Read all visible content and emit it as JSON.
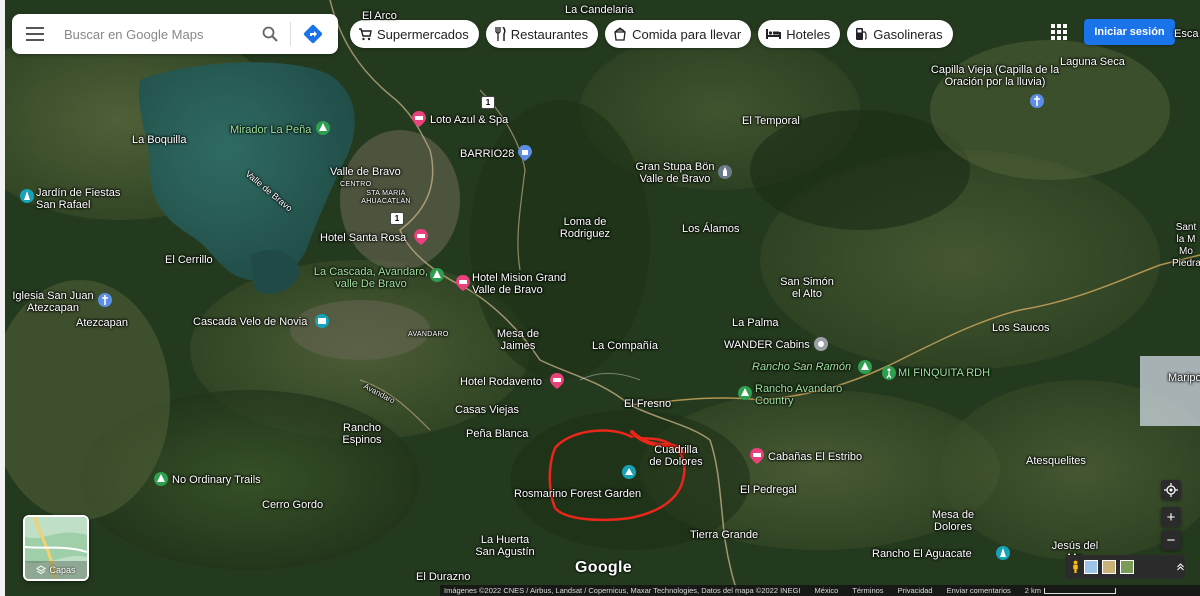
{
  "search": {
    "placeholder": "Buscar en Google Maps"
  },
  "chips": [
    {
      "label": "Supermercados",
      "icon": "cart-icon"
    },
    {
      "label": "Restaurantes",
      "icon": "fork-knife-icon"
    },
    {
      "label": "Comida para llevar",
      "icon": "takeout-icon"
    },
    {
      "label": "Hoteles",
      "icon": "bed-icon"
    },
    {
      "label": "Gasolineras",
      "icon": "gas-pump-icon"
    }
  ],
  "header": {
    "signin_label": "Iniciar sesión",
    "apps_icon": "grid-apps-icon"
  },
  "places": {
    "el_arco": "El Arco",
    "la_candelaria": "La Candelaria",
    "capilla_vieja": "Capilla Vieja (Capilla de la Oración por la lluvia)",
    "laguna_seca": "Laguna Seca",
    "escal": "Esca",
    "loto_azul": "Loto Azul & Spa",
    "la_boquilla": "La Boquilla",
    "mirador": "Mirador La Peña",
    "el_temporal": "El Temporal",
    "barrio28": "BARRIO28",
    "valle_de_bravo": "Valle de Bravo",
    "centro": "CENTRO",
    "sta_maria": "STA MARIA AHUACATLAN",
    "valle_lake": "Valle de Bravo",
    "gran_stupa": "Gran Stupa Bön Valle de Bravo",
    "jardin": "Jardín de Fiestas San Rafael",
    "loma": "Loma de Rodriguez",
    "los_alamos": "Los Álamos",
    "hotel_santa_rosa": "Hotel Santa Rosa",
    "el_cerrillo": "El Cerrillo",
    "la_cascada": "La Cascada, Avandaro, valle De Bravo",
    "hotel_mision": "Hotel Mision Grand Valle de Bravo",
    "san_simon": "San Simón el Alto",
    "iglesia": "Iglesia San Juan Atezcapan",
    "atezcapan": "Atezcapan",
    "cascada_velo": "Cascada Velo de Novia",
    "avandaro": "AVANDARO",
    "mesa_jaimes": "Mesa de Jaimes",
    "la_palma": "La Palma",
    "los_saucos": "Los Saucos",
    "la_compania": "La Compañía",
    "wander": "WANDER Cabins",
    "rancho_san_ramon": "Rancho San Ramón",
    "mi_finquita": "MI FINQUITA RDH",
    "hotel_rodavento": "Hotel Rodavento",
    "rancho_avandaro": "Rancho Avandaro Country",
    "el_fresno": "El Fresno",
    "casas_viejas": "Casas Viejas",
    "rancho_espinos": "Rancho Espinos",
    "pena_blanca": "Peña Blanca",
    "cuadrilla": "Cuadrilla de Dolores",
    "cabanas": "Cabañas El Estribo",
    "rosmarino": "Rosmarino Forest Garden",
    "el_pedregal": "El Pedregal",
    "atesquelites": "Atesquelites",
    "no_ordinary": "No Ordinary Trails",
    "cerro_gordo": "Cerro Gordo",
    "mesa_dolores": "Mesa de Dolores",
    "tierra_grande": "Tierra Grande",
    "la_huerta": "La Huerta San Agustín",
    "rancho_aguacate": "Rancho El Aguacate",
    "jesus_del": "Jesús del Mo",
    "el_durazno": "El Durazno",
    "santa_edge": "Sant la M Mo Piedra",
    "maripo": "Maripo",
    "road_avandaro": "Avandaro",
    "route_1a": "1",
    "route_1b": "1"
  },
  "layers": {
    "label": "Capas"
  },
  "brand": "Google",
  "controls": {
    "zoom_in": "+",
    "zoom_out": "−"
  },
  "footer": {
    "imagery": "Imágenes ©2022 CNES / Airbus, Landsat / Copernicus, Maxar Technologies, Datos del mapa ©2022 INEGI",
    "country": "México",
    "terms": "Términos",
    "privacy": "Privacidad",
    "feedback": "Enviar comentarios",
    "scale": "2 km"
  },
  "colors": {
    "signin_bg": "#1a73e8",
    "annotation": "#e8271a",
    "pin_red": "#e8417c",
    "pin_blue": "#5c8ee8",
    "pin_teal": "#17a2b8",
    "pin_green": "#2e9e4f"
  }
}
